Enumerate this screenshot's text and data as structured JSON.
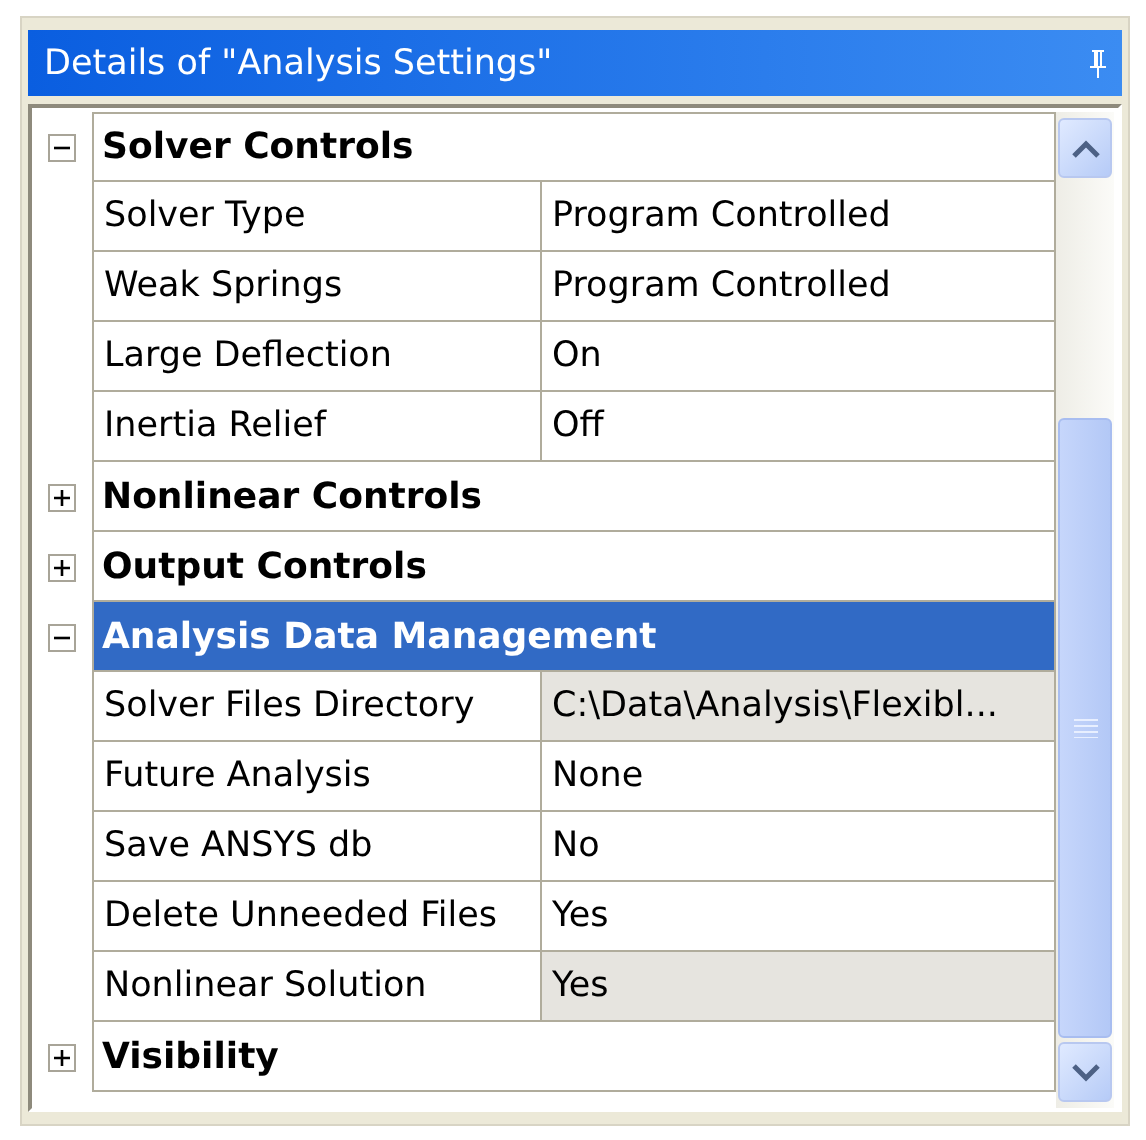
{
  "window": {
    "title": "Details of \"Analysis Settings\""
  },
  "sections": [
    {
      "title": "Solver Controls",
      "expanded": true,
      "selected": false,
      "rows": [
        {
          "name": "Solver Type",
          "value": "Program Controlled",
          "read_only": false
        },
        {
          "name": "Weak Springs",
          "value": "Program Controlled",
          "read_only": false
        },
        {
          "name": "Large Deflection",
          "value": "On",
          "read_only": false
        },
        {
          "name": "Inertia Relief",
          "value": "Off",
          "read_only": false
        }
      ]
    },
    {
      "title": "Nonlinear Controls",
      "expanded": false,
      "selected": false
    },
    {
      "title": "Output Controls",
      "expanded": false,
      "selected": false
    },
    {
      "title": "Analysis Data Management",
      "expanded": true,
      "selected": true,
      "rows": [
        {
          "name": "Solver Files Directory",
          "value": "C:\\Data\\Analysis\\Flexibl...",
          "read_only": true
        },
        {
          "name": "Future Analysis",
          "value": "None",
          "read_only": false
        },
        {
          "name": "Save ANSYS db",
          "value": "No",
          "read_only": false
        },
        {
          "name": "Delete Unneeded Files",
          "value": "Yes",
          "read_only": false
        },
        {
          "name": "Nonlinear Solution",
          "value": "Yes",
          "read_only": true
        }
      ]
    },
    {
      "title": "Visibility",
      "expanded": false,
      "selected": false
    }
  ]
}
